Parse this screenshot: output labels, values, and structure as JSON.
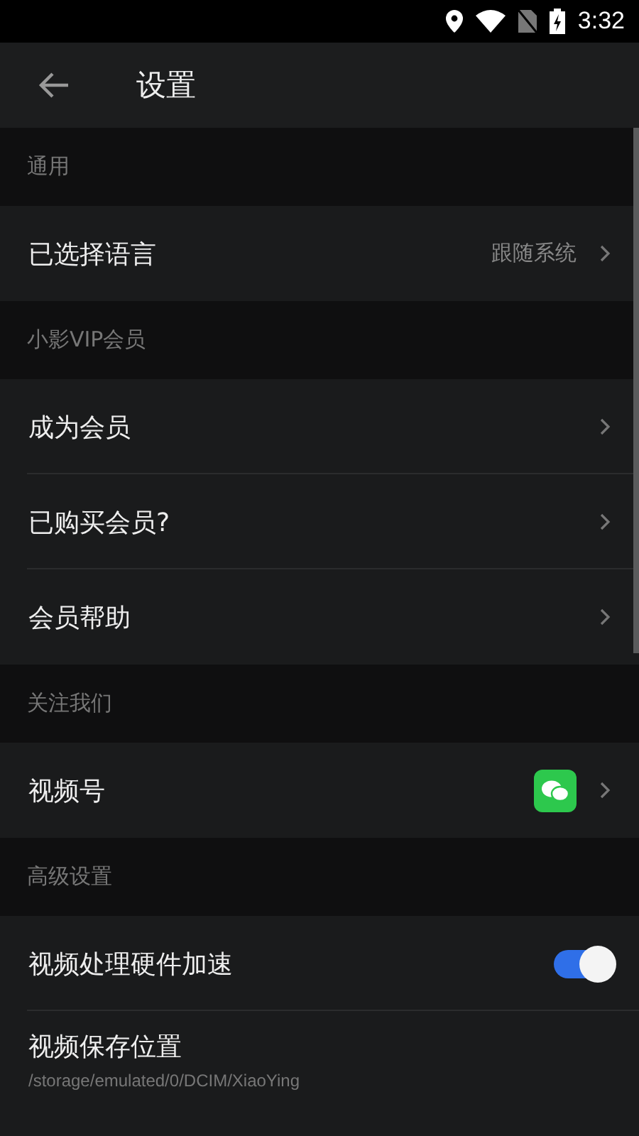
{
  "status_bar": {
    "time": "3:32"
  },
  "header": {
    "title": "设置"
  },
  "sections": [
    {
      "title": "通用",
      "items": [
        {
          "kind": "link",
          "label": "已选择语言",
          "value": "跟随系统"
        }
      ]
    },
    {
      "title": "小影VIP会员",
      "items": [
        {
          "kind": "link",
          "label": "成为会员"
        },
        {
          "kind": "link",
          "label": "已购买会员?"
        },
        {
          "kind": "link",
          "label": "会员帮助"
        }
      ]
    },
    {
      "title": "关注我们",
      "items": [
        {
          "kind": "wechat",
          "label": "视频号"
        }
      ]
    },
    {
      "title": "高级设置",
      "items": [
        {
          "kind": "toggle",
          "label": "视频处理硬件加速",
          "on": true
        },
        {
          "kind": "path",
          "label": "视频保存位置",
          "subtitle": "/storage/emulated/0/DCIM/XiaoYing"
        }
      ]
    }
  ]
}
